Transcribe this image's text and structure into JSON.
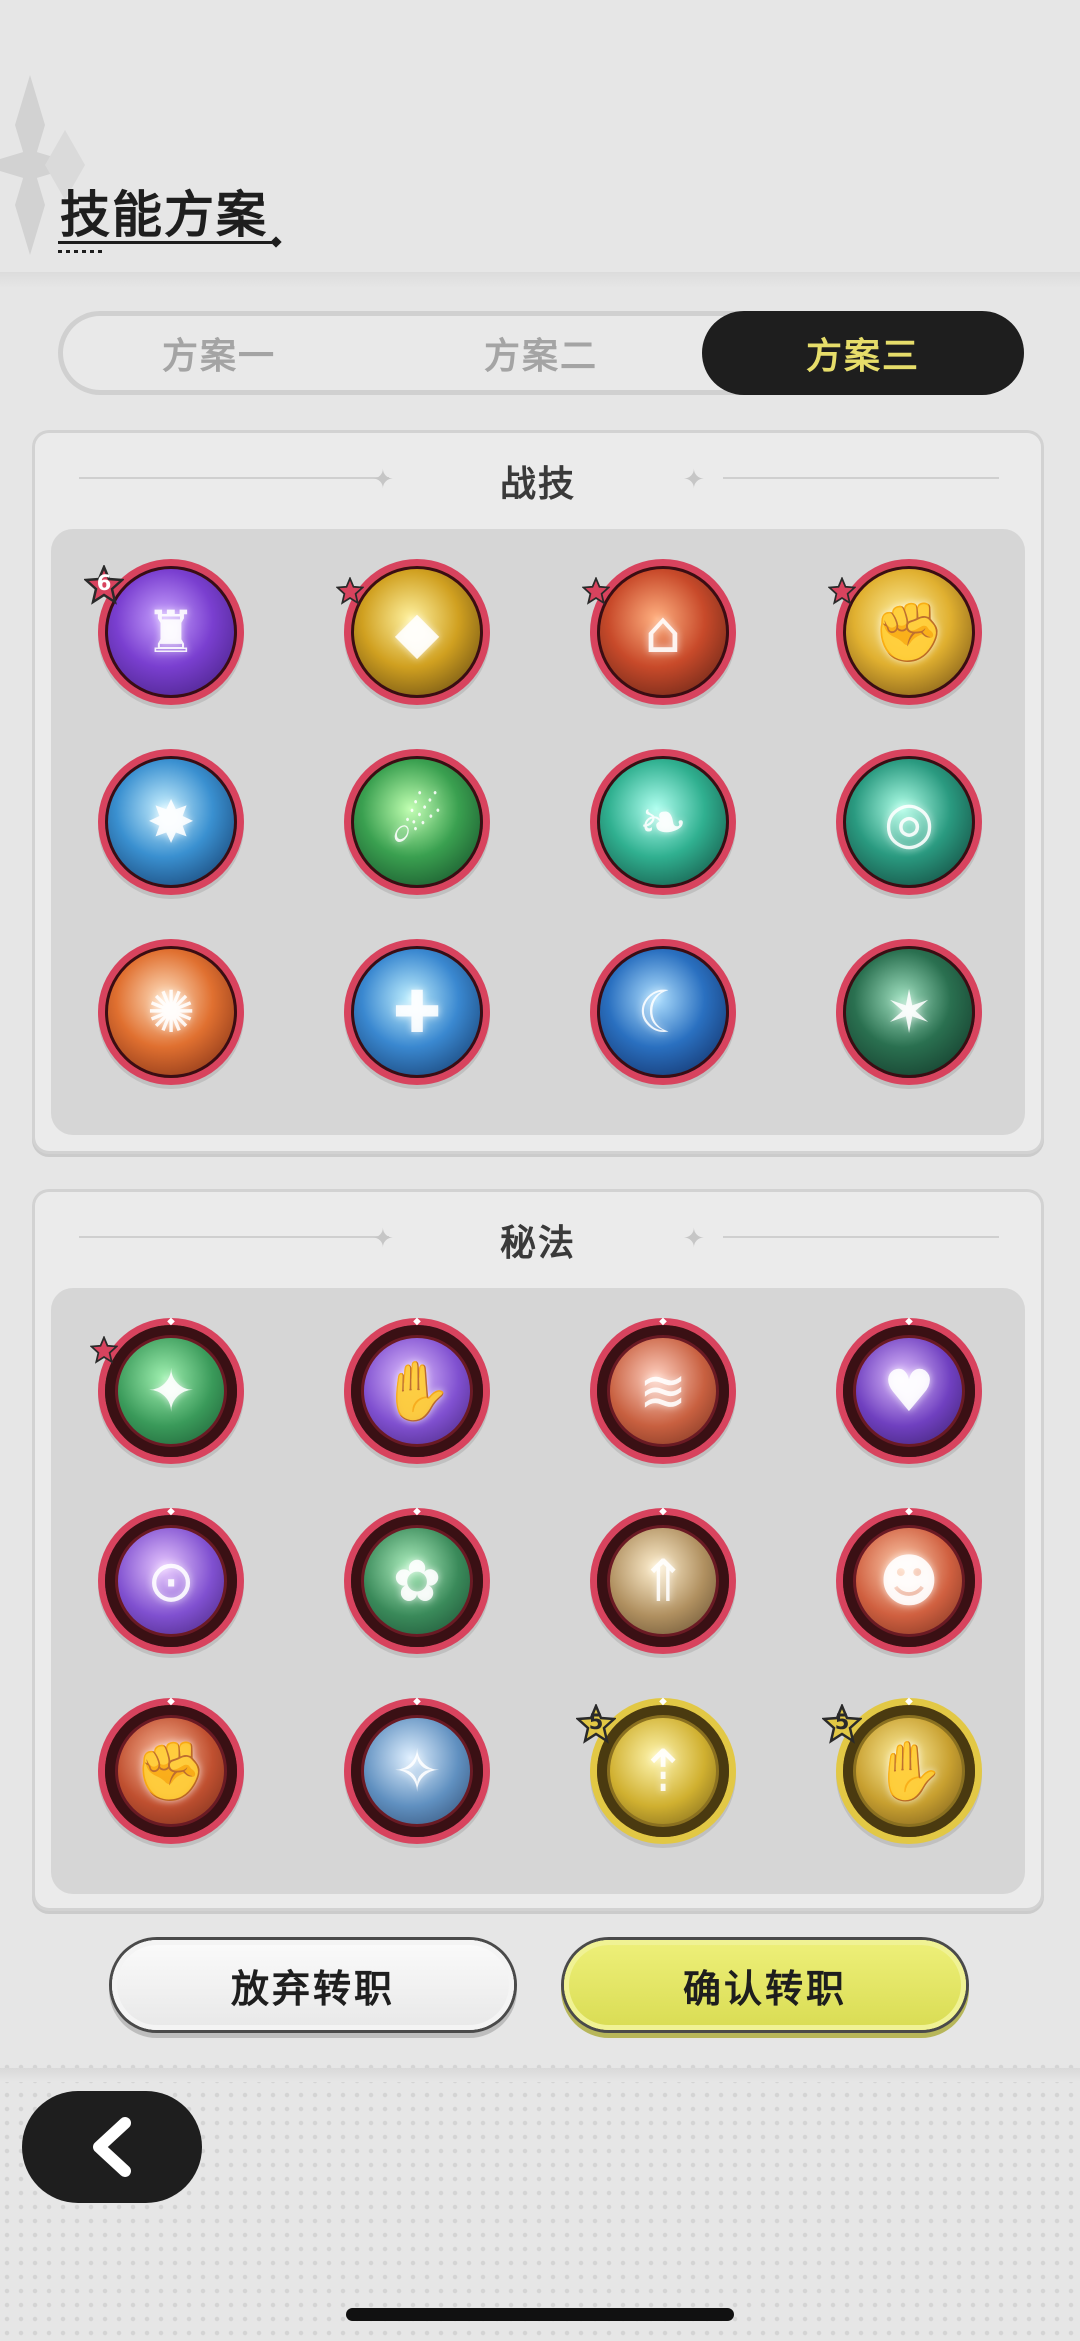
{
  "header": {
    "title": "技能方案"
  },
  "tabs": [
    {
      "label": "方案一",
      "active": false
    },
    {
      "label": "方案二",
      "active": false
    },
    {
      "label": "方案三",
      "active": true
    }
  ],
  "sections": {
    "combat": {
      "title": "战技",
      "skills": [
        {
          "glyph": "♜",
          "colors": [
            "#c9a3ff",
            "#7a3fd0",
            "#3a1a70"
          ],
          "badge": "6",
          "badge_type": "red-star"
        },
        {
          "glyph": "◆",
          "colors": [
            "#fff2a0",
            "#d0a020",
            "#4a3410"
          ],
          "badge": "",
          "badge_type": "red-star"
        },
        {
          "glyph": "⌂",
          "colors": [
            "#ffb080",
            "#c84a2a",
            "#4a1a12"
          ],
          "badge": "",
          "badge_type": "red-star"
        },
        {
          "glyph": "✊",
          "colors": [
            "#fff0a0",
            "#e0b030",
            "#5a3a10"
          ],
          "badge": "",
          "badge_type": "red-star"
        },
        {
          "glyph": "✸",
          "colors": [
            "#c8f0ff",
            "#3a90d0",
            "#0d2a55"
          ],
          "badge": "",
          "badge_type": ""
        },
        {
          "glyph": "☄",
          "colors": [
            "#c0ffb0",
            "#3aa050",
            "#0d3a20"
          ],
          "badge": "",
          "badge_type": ""
        },
        {
          "glyph": "❧",
          "colors": [
            "#b0fff0",
            "#30b090",
            "#0d3a30"
          ],
          "badge": "",
          "badge_type": ""
        },
        {
          "glyph": "◎",
          "colors": [
            "#b0ffe8",
            "#2a9a80",
            "#0d302a"
          ],
          "badge": "",
          "badge_type": ""
        },
        {
          "glyph": "✺",
          "colors": [
            "#ffe0c0",
            "#e07030",
            "#6a2010"
          ],
          "badge": "",
          "badge_type": ""
        },
        {
          "glyph": "✚",
          "colors": [
            "#c0f0ff",
            "#3a88d0",
            "#0d2a55"
          ],
          "badge": "",
          "badge_type": ""
        },
        {
          "glyph": "☾",
          "colors": [
            "#b0e0ff",
            "#2a70c0",
            "#0d2050"
          ],
          "badge": "",
          "badge_type": ""
        },
        {
          "glyph": "✶",
          "colors": [
            "#a0e0c0",
            "#2a7050",
            "#0d2a20"
          ],
          "badge": "",
          "badge_type": ""
        }
      ]
    },
    "arcane": {
      "title": "秘法",
      "skills": [
        {
          "glyph": "✦",
          "colors": [
            "#a0f0b0",
            "#3a9a5a",
            "#0d3a20"
          ],
          "badge": "",
          "badge_type": "red-star",
          "frame": "red"
        },
        {
          "glyph": "✋",
          "colors": [
            "#e0c0ff",
            "#8050d0",
            "#2a1050"
          ],
          "badge": "",
          "badge_type": "",
          "frame": "red"
        },
        {
          "glyph": "≋",
          "colors": [
            "#ffd0c0",
            "#c86040",
            "#4a1a10"
          ],
          "badge": "",
          "badge_type": "",
          "frame": "red"
        },
        {
          "glyph": "♥",
          "colors": [
            "#e0c0ff",
            "#7040c0",
            "#201040"
          ],
          "badge": "",
          "badge_type": "",
          "frame": "red"
        },
        {
          "glyph": "⊙",
          "colors": [
            "#e8c8ff",
            "#8050d0",
            "#2a1050"
          ],
          "badge": "",
          "badge_type": "",
          "frame": "red"
        },
        {
          "glyph": "✿",
          "colors": [
            "#b0f0c0",
            "#3a8a5a",
            "#0d3020"
          ],
          "badge": "",
          "badge_type": "",
          "frame": "red"
        },
        {
          "glyph": "⇑",
          "colors": [
            "#fff0d0",
            "#b09060",
            "#3a2a18"
          ],
          "badge": "",
          "badge_type": "",
          "frame": "red"
        },
        {
          "glyph": "☻",
          "colors": [
            "#ffd0b0",
            "#d06040",
            "#4a1a10"
          ],
          "badge": "",
          "badge_type": "",
          "frame": "red"
        },
        {
          "glyph": "✊",
          "colors": [
            "#ffc0a0",
            "#c05030",
            "#4a1a10"
          ],
          "badge": "",
          "badge_type": "",
          "frame": "red"
        },
        {
          "glyph": "✧",
          "colors": [
            "#e0f0ff",
            "#6090c0",
            "#1a2a4a"
          ],
          "badge": "",
          "badge_type": "",
          "frame": "red"
        },
        {
          "glyph": "⇡",
          "colors": [
            "#fff6b0",
            "#d0b030",
            "#4a3a10"
          ],
          "badge": "5",
          "badge_type": "gold-star",
          "frame": "gold"
        },
        {
          "glyph": "✋",
          "colors": [
            "#fff0a0",
            "#c8a030",
            "#4a3410"
          ],
          "badge": "5",
          "badge_type": "gold-star",
          "frame": "gold"
        }
      ]
    }
  },
  "buttons": {
    "abandon": "放弃转职",
    "confirm": "确认转职"
  },
  "colors": {
    "accent_active_tab_text": "#e6dd6a",
    "frame_red": "#d8435e",
    "frame_gold": "#e2c845",
    "confirm_button": "#e0e35a",
    "dark": "#1e1e1e"
  },
  "icons": {
    "back": "chevron-left-icon"
  }
}
